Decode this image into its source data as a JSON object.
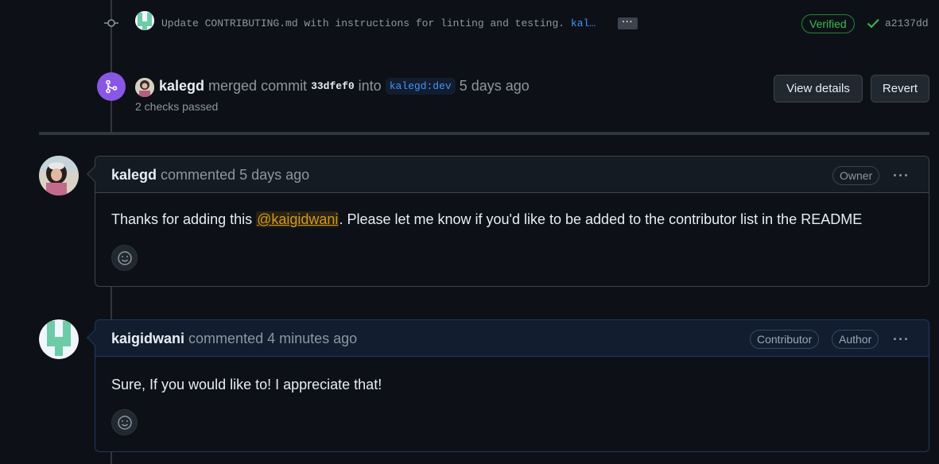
{
  "commit": {
    "message": "Update CONTRIBUTING.md with instructions for linting and testing.",
    "link_text": "kal…",
    "ellipsis": "···",
    "verified_label": "Verified",
    "sha": "a2137dd"
  },
  "merge_event": {
    "user": "kalegd",
    "action": "merged commit",
    "commit_sha": "33dfef0",
    "into_word": "into",
    "branch": "kalegd:dev",
    "time": "5 days ago",
    "checks": "2 checks passed",
    "view_details_label": "View details",
    "revert_label": "Revert"
  },
  "comments": [
    {
      "user": "kalegd",
      "action": "commented",
      "time": "5 days ago",
      "badges": [
        "Owner"
      ],
      "body_before": "Thanks for adding this ",
      "mention": "@kaigidwani",
      "body_after": ". Please let me know if you'd like to be added to the contributor list in the README",
      "menu": "···"
    },
    {
      "user": "kaigidwani",
      "action": "commented",
      "time": "4 minutes ago",
      "badges": [
        "Contributor",
        "Author"
      ],
      "body": "Sure, If you would like to! I appreciate that!",
      "menu": "···"
    }
  ],
  "colors": {
    "background": "#0d1117",
    "merge_purple": "#8957e5",
    "verified_green": "#3fb950",
    "link_blue": "#4493f8",
    "mention_orange": "#d29922"
  }
}
